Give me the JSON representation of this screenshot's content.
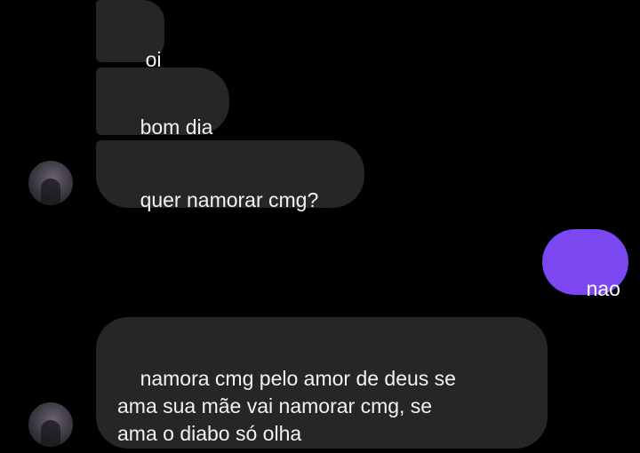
{
  "messages": [
    {
      "sender": "them",
      "text": "oi"
    },
    {
      "sender": "them",
      "text": "bom dia"
    },
    {
      "sender": "them",
      "text": "quer namorar cmg?"
    },
    {
      "sender": "me",
      "text": "nao"
    },
    {
      "sender": "them",
      "text": "namora cmg pelo amor de deus se\nama sua mãe vai namorar cmg, se\nama o diabo só olha"
    }
  ],
  "colors": {
    "background": "#000000",
    "incoming_bubble": "#262626",
    "outgoing_bubble": "#7a47f0",
    "text": "#f2f2f2"
  },
  "icons": {
    "avatar": "contact-avatar"
  }
}
